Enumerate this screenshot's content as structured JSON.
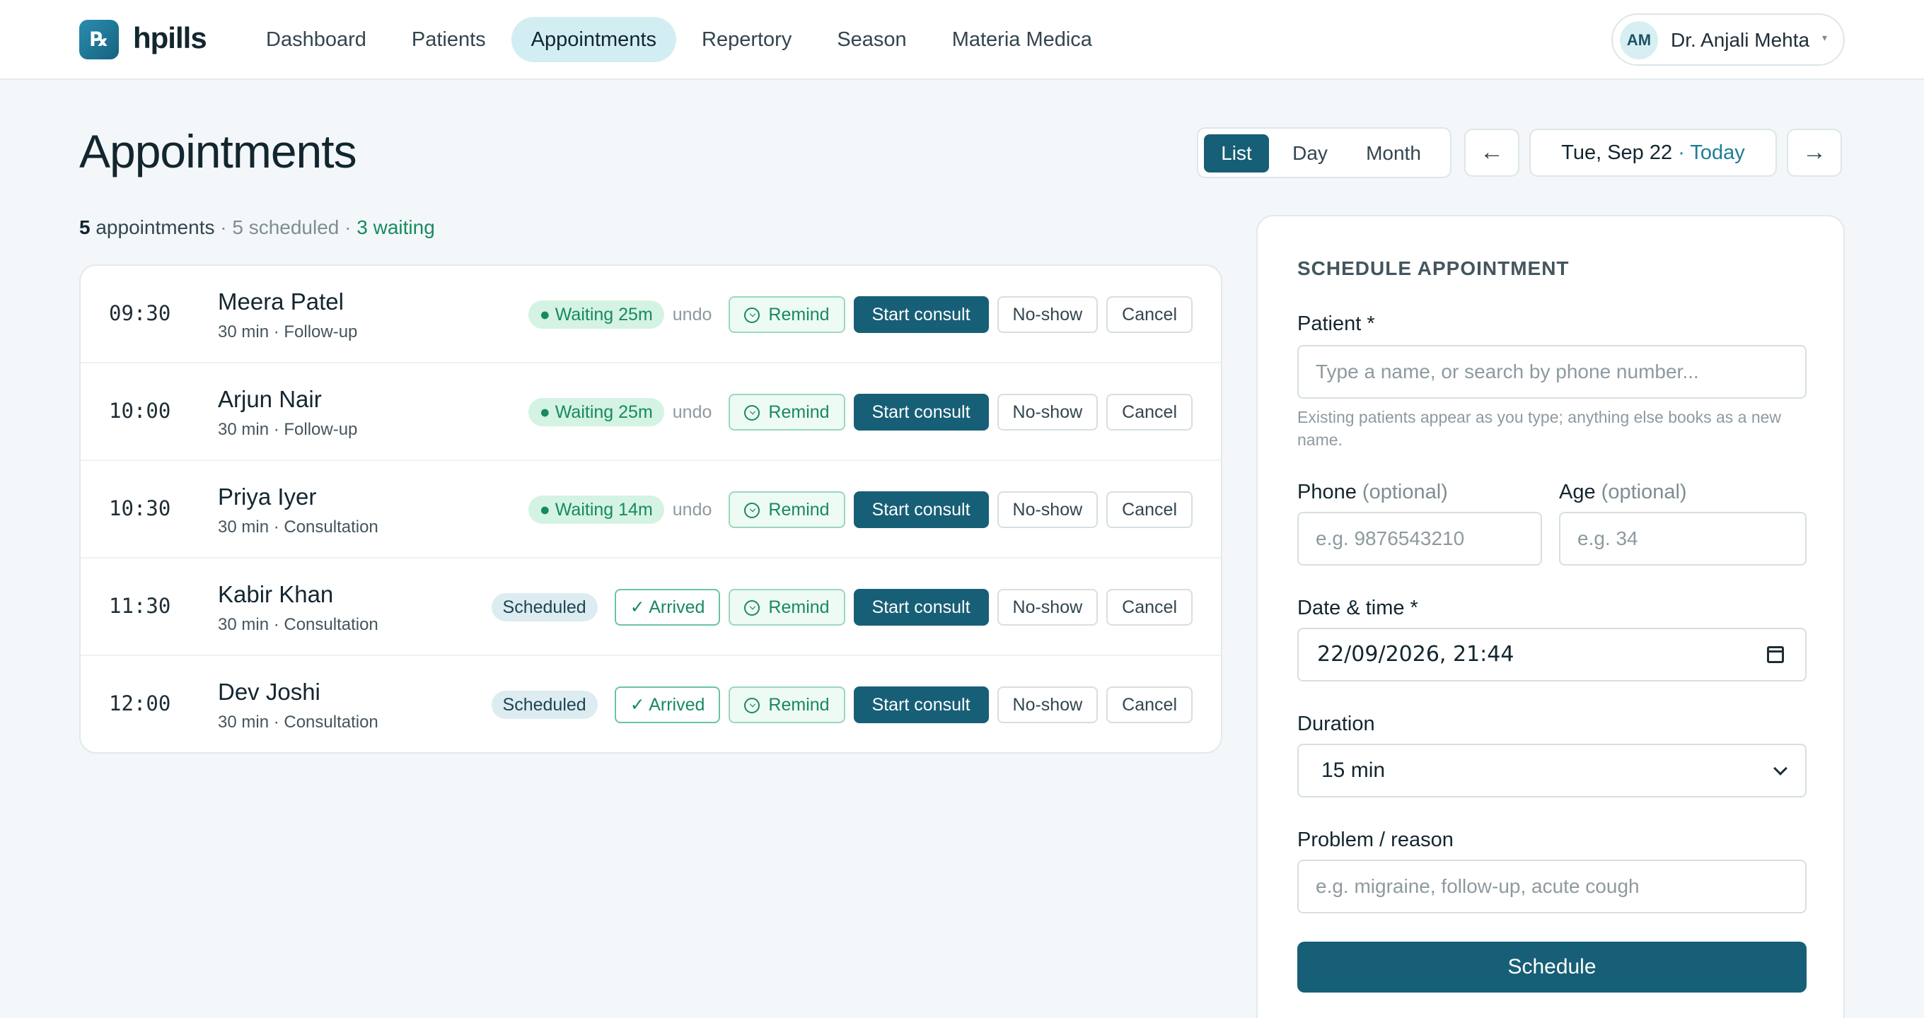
{
  "app": {
    "logo_letter": "℞",
    "name": "hpills"
  },
  "nav": {
    "items": [
      {
        "label": "Dashboard",
        "active": false
      },
      {
        "label": "Patients",
        "active": false
      },
      {
        "label": "Appointments",
        "active": true
      },
      {
        "label": "Repertory",
        "active": false
      },
      {
        "label": "Season",
        "active": false
      },
      {
        "label": "Materia Medica",
        "active": false
      }
    ]
  },
  "user": {
    "initials": "AM",
    "name": "Dr. Anjali Mehta",
    "caret": "▾"
  },
  "page": {
    "title": "Appointments"
  },
  "summary": {
    "count": "5",
    "count_label": "appointments",
    "sep1": "·",
    "scheduled": "5 scheduled",
    "sep2": "·",
    "waiting": "3 waiting"
  },
  "view_toggle": {
    "list": "List",
    "day": "Day",
    "month": "Month",
    "active": "List"
  },
  "date_nav": {
    "prev": "←",
    "next": "→",
    "date": "Tue, Sep 22",
    "sep": "·",
    "today": "Today"
  },
  "appointments": [
    {
      "time": "09:30",
      "name": "Meera Patel",
      "meta": "30 min · Follow-up",
      "status": "waiting",
      "status_label": "● Waiting 25m",
      "undo": "undo",
      "remind": "Remind",
      "start": "Start consult",
      "no_show": "No-show",
      "cancel": "Cancel"
    },
    {
      "time": "10:00",
      "name": "Arjun Nair",
      "meta": "30 min · Follow-up",
      "status": "waiting",
      "status_label": "● Waiting 25m",
      "undo": "undo",
      "remind": "Remind",
      "start": "Start consult",
      "no_show": "No-show",
      "cancel": "Cancel"
    },
    {
      "time": "10:30",
      "name": "Priya Iyer",
      "meta": "30 min · Consultation",
      "status": "waiting",
      "status_label": "● Waiting 14m",
      "undo": "undo",
      "remind": "Remind",
      "start": "Start consult",
      "no_show": "No-show",
      "cancel": "Cancel"
    },
    {
      "time": "11:30",
      "name": "Kabir Khan",
      "meta": "30 min · Consultation",
      "status": "scheduled",
      "status_label": "Scheduled",
      "arrived": "✓ Arrived",
      "remind": "Remind",
      "start": "Start consult",
      "no_show": "No-show",
      "cancel": "Cancel"
    },
    {
      "time": "12:00",
      "name": "Dev Joshi",
      "meta": "30 min · Consultation",
      "status": "scheduled",
      "status_label": "Scheduled",
      "arrived": "✓ Arrived",
      "remind": "Remind",
      "start": "Start consult",
      "no_show": "No-show",
      "cancel": "Cancel"
    }
  ],
  "form": {
    "heading": "SCHEDULE APPOINTMENT",
    "patient_label": "Patient *",
    "patient_placeholder": "Type a name, or search by phone number...",
    "patient_hint": "Existing patients appear as you type; anything else books as a new name.",
    "phone_label": "Phone",
    "phone_optional": "(optional)",
    "phone_placeholder": "e.g. 9876543210",
    "age_label": "Age",
    "age_optional": "(optional)",
    "age_placeholder": "e.g. 34",
    "datetime_label": "Date & time *",
    "datetime_value": "22/09/2026, 21:44",
    "duration_label": "Duration",
    "duration_value": "15 min",
    "problem_label": "Problem / reason",
    "problem_placeholder": "e.g. migraine, follow-up, acute cough",
    "submit": "Schedule"
  },
  "icons": {
    "remind": "whatsapp-icon",
    "datetime": "calendar-icon",
    "duration": "chevron-down-icon",
    "user_menu": "caret-down-icon"
  },
  "colors": {
    "primary": "#175f76",
    "waiting_bg": "#d4f3e2",
    "waiting_text": "#178a5e",
    "nav_active_bg": "#d2eef2",
    "background": "#f3f7f9"
  }
}
